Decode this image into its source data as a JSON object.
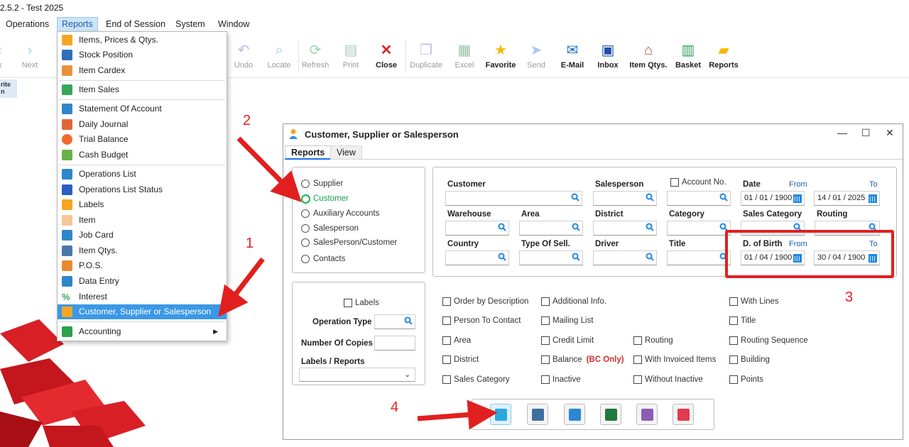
{
  "window": {
    "title": "2.5.2 - Test 2025"
  },
  "menubar": {
    "items": [
      "Operations",
      "Reports",
      "End of Session",
      "System",
      "Window"
    ]
  },
  "toolbar": {
    "items": [
      {
        "label": "k",
        "icon": "back-icon"
      },
      {
        "label": "Next",
        "icon": "chevron-right-icon"
      },
      {
        "label": "Undo",
        "icon": "undo-icon"
      },
      {
        "label": "Locate",
        "icon": "search-icon"
      },
      {
        "label": "Refresh",
        "icon": "refresh-icon"
      },
      {
        "label": "Print",
        "icon": "print-icon"
      },
      {
        "label": "Close",
        "icon": "close-icon"
      },
      {
        "label": "Duplicate",
        "icon": "duplicate-icon"
      },
      {
        "label": "Excel",
        "icon": "excel-icon"
      },
      {
        "label": "Favorite",
        "icon": "star-icon"
      },
      {
        "label": "Send",
        "icon": "send-icon"
      },
      {
        "label": "E-Mail",
        "icon": "mail-icon"
      },
      {
        "label": "Inbox",
        "icon": "inbox-icon"
      },
      {
        "label": "Item Qtys.",
        "icon": "warehouse-icon"
      },
      {
        "label": "Basket",
        "icon": "basket-icon"
      },
      {
        "label": "Reports",
        "icon": "folder-icon"
      }
    ],
    "favorites_stub": "rite\nn"
  },
  "dropdown": {
    "items": [
      {
        "label": "Items, Prices & Qtys.",
        "color": "#f5a623"
      },
      {
        "label": "Stock Position",
        "color": "#2f6fb6"
      },
      {
        "label": "Item Cardex",
        "color": "#e8913a"
      },
      {
        "label": "Item Sales",
        "color": "#3aa65a"
      },
      {
        "label": "Statement Of Account",
        "color": "#2f86c9"
      },
      {
        "label": "Daily Journal",
        "color": "#e0663a"
      },
      {
        "label": "Trial Balance",
        "color": "#f06a2f"
      },
      {
        "label": "Cash Budget",
        "color": "#6bb04a"
      },
      {
        "label": "Operations List",
        "color": "#2f86c9"
      },
      {
        "label": "Operations List Status",
        "color": "#2b5fbf"
      },
      {
        "label": "Labels",
        "color": "#f5a623"
      },
      {
        "label": "Item",
        "color": "#f3c89a"
      },
      {
        "label": "Job Card",
        "color": "#2f86c9"
      },
      {
        "label": "Item Qtys.",
        "color": "#4a78a8"
      },
      {
        "label": "P.O.S.",
        "color": "#e88a2f"
      },
      {
        "label": "Data Entry",
        "color": "#2f86c9"
      },
      {
        "label": "Interest",
        "color": "#3aa65a"
      },
      {
        "label": "Customer, Supplier or Salesperson",
        "color": "#f5a623"
      },
      {
        "label": "Accounting",
        "color": "#2ca24a"
      }
    ]
  },
  "dialog": {
    "title": "Customer, Supplier or Salesperson",
    "tabs": [
      "Reports",
      "View"
    ],
    "radios": [
      "Supplier",
      "Customer",
      "Auxiliary Accounts",
      "Salesperson",
      "SalesPerson/Customer",
      "Contacts"
    ],
    "selected_radio": "Customer",
    "fields": {
      "customer": "Customer",
      "salesperson": "Salesperson",
      "account_no": "Account No.",
      "date": "Date",
      "from": "From",
      "to": "To",
      "date_from": "01 / 01 / 1900",
      "date_to": "14 / 01 / 2025",
      "warehouse": "Warehouse",
      "area": "Area",
      "district": "District",
      "category": "Category",
      "sales_category": "Sales Category",
      "routing": "Routing",
      "country": "Country",
      "type_of_sell": "Type Of Sell.",
      "driver": "Driver",
      "title": "Title",
      "dob": "D. of Birth",
      "dob_from": "01 / 04 / 1900",
      "dob_to": "30 / 04 / 1900"
    },
    "left_panel": {
      "labels_check": "Labels",
      "operation_type": "Operation Type",
      "number_of_copies": "Number Of Copies",
      "labels_reports": "Labels / Reports"
    },
    "checks": {
      "col1": [
        "Order by Description",
        "Person To Contact",
        "Area",
        "District",
        "Sales Category"
      ],
      "col2": [
        "Additional Info.",
        "Mailing List",
        "Credit Limit",
        "Balance",
        "Inactive"
      ],
      "col3": [
        "Routing",
        "With Invoiced Items",
        "Without Inactive"
      ],
      "col4": [
        "With Lines",
        "Title",
        "Routing Sequence",
        "Building",
        "Points"
      ],
      "bc_only": "(BC Only)"
    },
    "actions": [
      {
        "icon": "preview-icon",
        "color": "#29a8e0"
      },
      {
        "icon": "print-icon",
        "color": "#3d6e9e"
      },
      {
        "icon": "grid-icon",
        "color": "#2b87d4"
      },
      {
        "icon": "excel-icon",
        "color": "#1f7a3c"
      },
      {
        "icon": "undo-icon",
        "color": "#8e5bb5"
      },
      {
        "icon": "exit-icon",
        "color": "#e23a4f"
      }
    ]
  },
  "annotations": [
    "1",
    "2",
    "3",
    "4"
  ],
  "colors": {
    "highlight": "#e21f1f",
    "selection": "#3b98e6",
    "accent": "#1a73e8"
  }
}
